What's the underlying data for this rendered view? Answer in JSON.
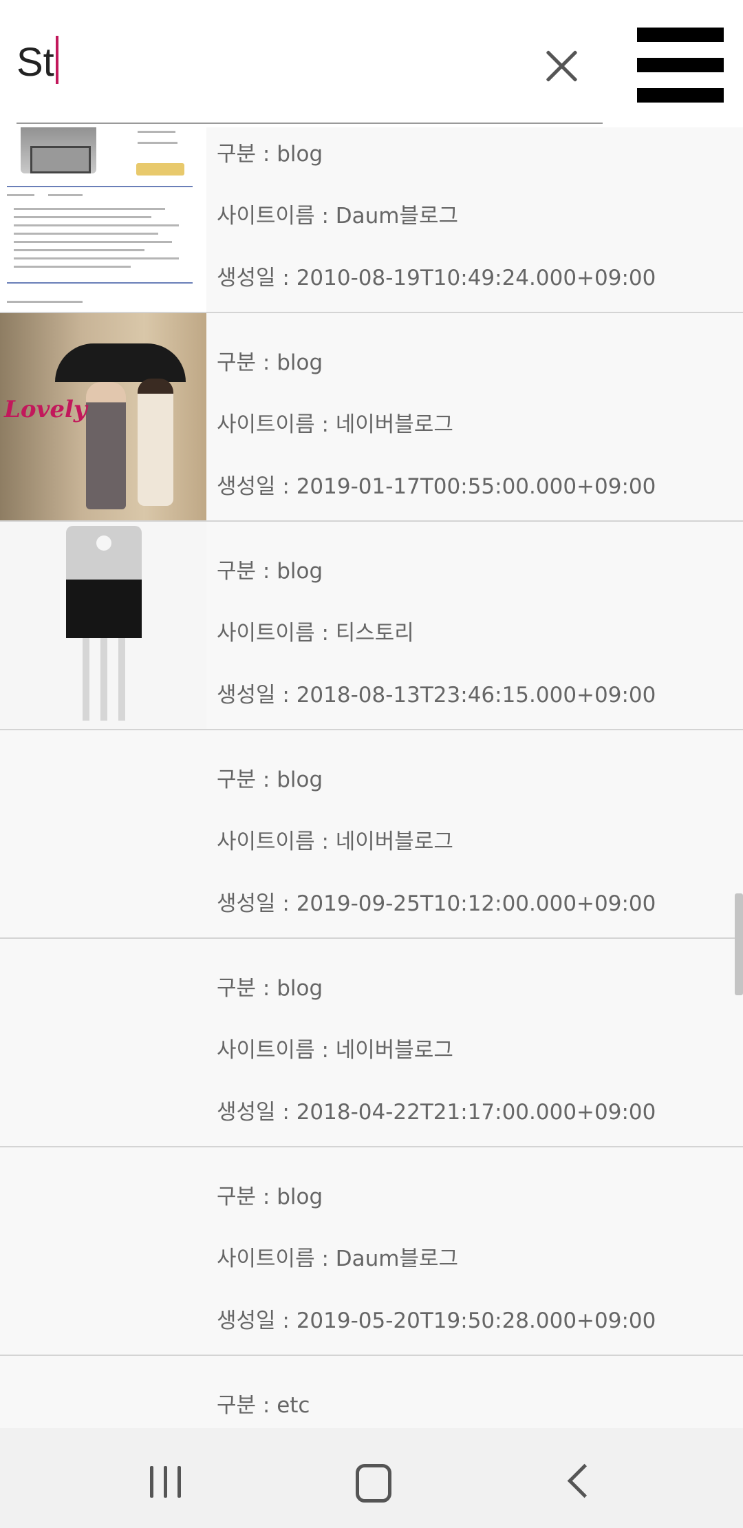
{
  "search": {
    "query": "St"
  },
  "results": [
    {
      "category": "구분 : blog",
      "site": "사이트이름 : Daum블로그",
      "created": "생성일 : 2010-08-19T10:49:24.000+09:00"
    },
    {
      "category": "구분 : blog",
      "site": "사이트이름 : 네이버블로그",
      "created": "생성일 : 2019-01-17T00:55:00.000+09:00",
      "thumb_text": "Lovely"
    },
    {
      "category": "구분 : blog",
      "site": "사이트이름 : 티스토리",
      "created": "생성일 : 2018-08-13T23:46:15.000+09:00"
    },
    {
      "category": "구분 : blog",
      "site": "사이트이름 : 네이버블로그",
      "created": "생성일 : 2019-09-25T10:12:00.000+09:00"
    },
    {
      "category": "구분 : blog",
      "site": "사이트이름 : 네이버블로그",
      "created": "생성일 : 2018-04-22T21:17:00.000+09:00"
    },
    {
      "category": "구분 : blog",
      "site": "사이트이름 : Daum블로그",
      "created": "생성일 : 2019-05-20T19:50:28.000+09:00"
    },
    {
      "category": "구분 : etc"
    }
  ],
  "icons": {
    "clear": "close-icon",
    "menu": "hamburger-menu-icon",
    "recent": "recent-apps-icon",
    "home": "home-icon",
    "back": "back-icon"
  },
  "colors": {
    "caret": "#c2185b",
    "text": "#666666",
    "divider": "#d4d4d4"
  }
}
